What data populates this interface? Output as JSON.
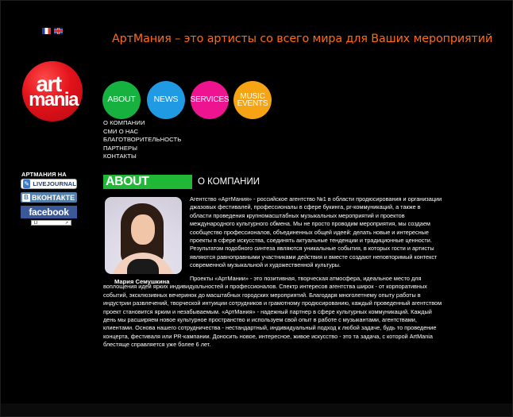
{
  "languages": {
    "fr_icon": "flag-fr-icon",
    "en_icon": "flag-en-icon"
  },
  "tagline": "АртМания – это артисты со всего мира для Ваших мероприятий",
  "logo": {
    "line1": "art",
    "line2": "mania"
  },
  "nav": [
    {
      "label": "ABOUT",
      "color": "#17b13f"
    },
    {
      "label": "NEWS",
      "color": "#1f9ae3"
    },
    {
      "label": "SERVICES",
      "color": "#ee138e"
    },
    {
      "label": "MUSIC EVENTS",
      "color": "#f7a414"
    }
  ],
  "submenu": [
    "О КОМПАНИИ",
    "СМИ О НАС",
    "БЛАГОТВОРИТЕЛЬНОСТЬ",
    "ПАРТНЕРЫ",
    "КОНТАКТЫ"
  ],
  "social": {
    "title": "АРТМАНИЯ НА",
    "livejournal": "LIVEJOURNAL",
    "vkontakte": "ВКОНТАКТЕ",
    "vk_letter": "В",
    "facebook": "facebook",
    "counter_left": "LI",
    "counter_right": "↗"
  },
  "section": {
    "badge": "ABOUT",
    "title": "О КОМПАНИИ",
    "photo_caption": "Мария Семушкина",
    "paragraph1": "Агентство «АртМания» - российское агентство №1 в области продюсирования и организации джазовых фестивалей, профессионалы в сфере букинга, pr-коммуникаций, а также в области проведения крупномасштабных музыкальных мероприятий и проектов международного культурного обмена. Мы не просто проводим мероприятия, мы создаем сообщество профессионалов, объединенных общей идеей: делать новые и интересные проекты в сфере искусства, соединять актуальные тенденции и традиционные ценности. Результатом подобного синтеза являются уникальные события, в которых гости и артисты являются равноправными участниками действия и вместе создают неповторимый контекст современной музыкальной и художественной культуры.",
    "paragraph2": "Проекты «АртМании» - это позитивная, творческая атмосфера, идеальное место для воплощения идей ярких индивидуальностей и профессионалов. Спектр интересов агентства широк - от корпоративных событий, эксклюзивных вечеринок до масштабных городских мероприятий. Благодаря многолетнему опыту работы в индустрии развлечений, творческой интуиции сотрудников и грамотному продюсированию, каждый проведенный агентством проект становится ярким и незабываемым. «АртМания» - надежный партнер в сфере культурных коммуникаций. Каждый день мы расширяем новое культурное пространство и используем свой опыт в работе с музыкантами, агентствами, клиентами. Основа нашего сотрудничества - нестандартный, индивидуальный подход к любой задаче, будь то проведение концерта, фестиваля или PR-кампании. Доносить новое, интересное, живое искусство - это та задача, с которой ArtMania блестяще справляется уже более 6 лет."
  }
}
